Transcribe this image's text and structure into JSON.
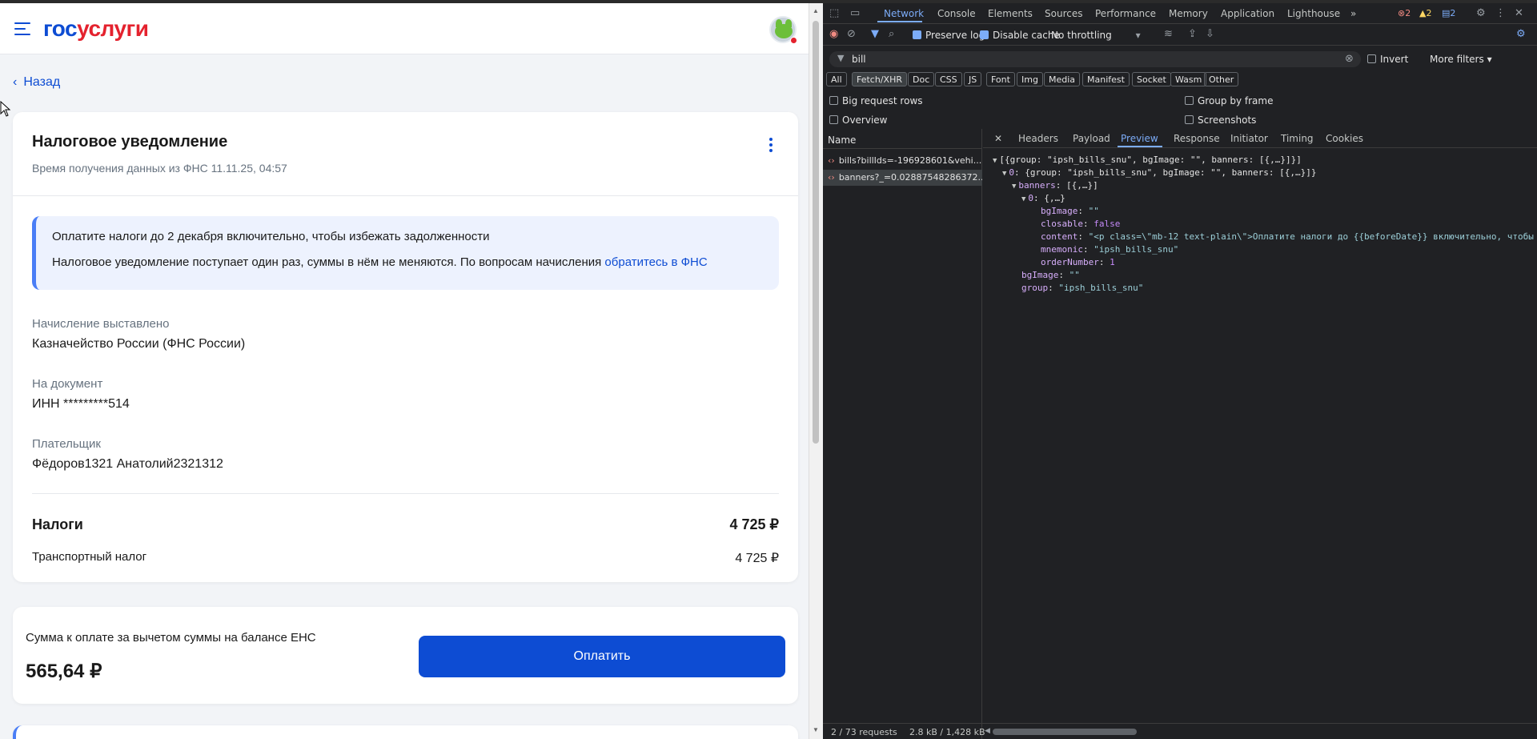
{
  "site": {
    "logo_part1": "гос",
    "logo_part2": "услуги"
  },
  "nav": {
    "back_label": "Назад"
  },
  "notice": {
    "title": "Налоговое уведомление",
    "subtitle": "Время получения данных из ФНС 11.11.25, 04:57",
    "info_line1": "Оплатите налоги до 2 декабря включительно, чтобы избежать задолженности",
    "info_line2": "Налоговое уведомление поступает один раз, суммы в нём не меняются. По вопросам начисления",
    "info_link": "обратитесь в ФНС",
    "issuer_label": "Начисление выставлено",
    "issuer_value": "Казначейство России (ФНС России)",
    "doc_label": "На документ",
    "doc_value": "ИНН *********514",
    "payer_label": "Плательщик",
    "payer_value": "Фёдоров1321 Анатолий2321312",
    "taxes_label": "Налоги",
    "taxes_total": "4 725 ₽",
    "item_label": "Транспортный налог",
    "item_value": "4 725 ₽"
  },
  "payment": {
    "label": "Сумма к оплате за вычетом суммы на балансе ЕНС",
    "amount": "565,64 ₽",
    "button": "Оплатить"
  },
  "devtools": {
    "tabs": [
      "Network",
      "Console",
      "Elements",
      "Sources",
      "Performance",
      "Memory",
      "Application",
      "Lighthouse"
    ],
    "errors": "2",
    "warnings": "2",
    "messages": "2",
    "preserve_log": "Preserve log",
    "disable_cache": "Disable cache",
    "throttling": "No throttling",
    "filter_value": "bill",
    "invert": "Invert",
    "more_filters": "More filters",
    "type_filters": [
      "All",
      "Fetch/XHR",
      "Doc",
      "CSS",
      "JS",
      "Font",
      "Img",
      "Media",
      "Manifest",
      "Socket",
      "Wasm",
      "Other"
    ],
    "opt_big_rows": "Big request rows",
    "opt_group_frame": "Group by frame",
    "opt_overview": "Overview",
    "opt_screenshots": "Screenshots",
    "name_header": "Name",
    "requests": [
      "bills?billIds=-196928601&vehi...",
      "banners?_=0.02887548286372..."
    ],
    "detail_tabs": [
      "Headers",
      "Payload",
      "Preview",
      "Response",
      "Initiator",
      "Timing",
      "Cookies"
    ],
    "json": {
      "l1": "[{group: \"ipsh_bills_snu\", bgImage: \"\", banners: [{,…}]}]",
      "l2_key": "0",
      "l2_val": "{group: \"ipsh_bills_snu\", bgImage: \"\", banners: [{,…}]}",
      "l3_key": "banners",
      "l3_val": "[{,…}]",
      "l4_key": "0",
      "l4_val": "{,…}",
      "bgImage_key": "bgImage",
      "bgImage_val": "\"\"",
      "closable_key": "closable",
      "closable_val": "false",
      "content_key": "content",
      "content_val": "\"<p class=\\\"mb-12 text-plain\\\">Оплатите налоги до {{beforeDate}} включительно, чтобы",
      "mnemonic_key": "mnemonic",
      "mnemonic_val": "\"ipsh_bills_snu\"",
      "order_key": "orderNumber",
      "order_val": "1",
      "bgImage2_key": "bgImage",
      "bgImage2_val": "\"\"",
      "group_key": "group",
      "group_val": "\"ipsh_bills_snu\""
    },
    "status_requests": "2 / 73 requests",
    "status_size": "2.8 kB / 1,428 kB"
  }
}
